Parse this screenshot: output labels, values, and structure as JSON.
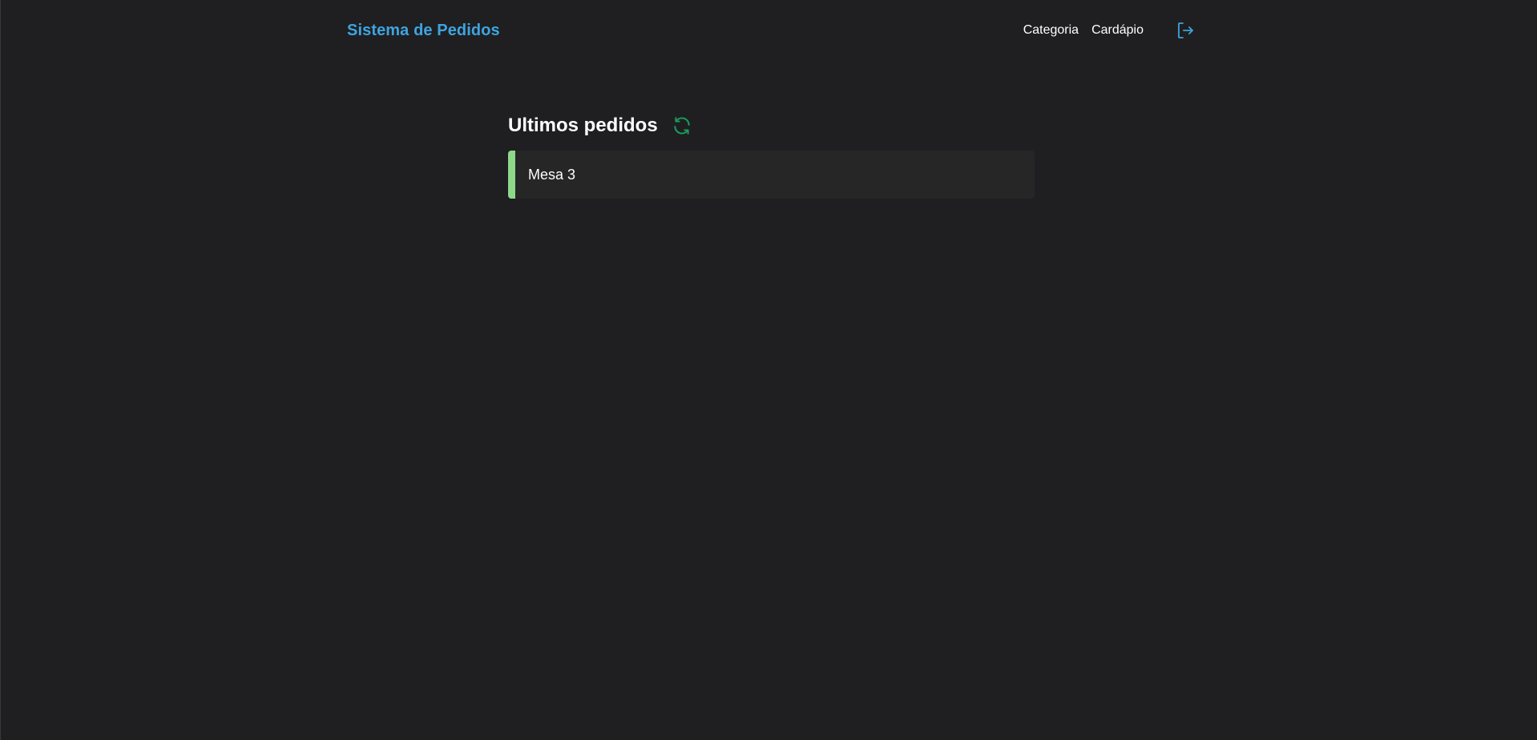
{
  "header": {
    "brand": "Sistema de Pedidos",
    "nav": [
      {
        "label": "Categoria"
      },
      {
        "label": "Cardápio"
      }
    ],
    "logout_icon": "logout-icon"
  },
  "main": {
    "title": "Ultimos pedidos",
    "refresh_icon": "refresh-icon",
    "orders": [
      {
        "label": "Mesa 3",
        "status_color": "#8fd88a"
      }
    ]
  },
  "colors": {
    "background": "#1f1f21",
    "brand": "#3fa4e0",
    "accent_green": "#1a9e5c",
    "order_bar": "#8fd88a",
    "card": "#262627"
  }
}
